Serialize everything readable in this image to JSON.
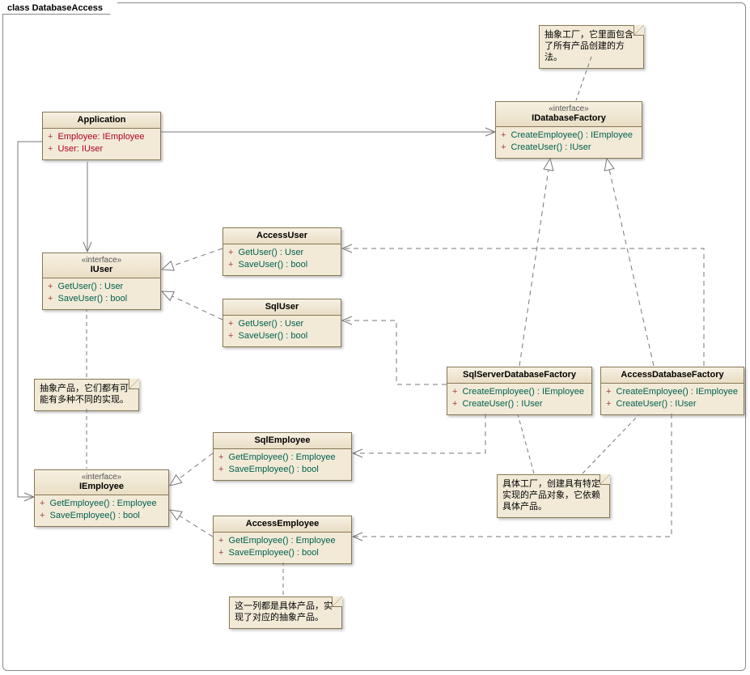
{
  "frame": {
    "title": "class DatabaseAccess"
  },
  "classes": {
    "Application": {
      "name": "Application",
      "attrs": [
        "Employee:  IEmployee",
        "User:  IUser"
      ]
    },
    "IDatabaseFactory": {
      "stereo": "«interface»",
      "name": "IDatabaseFactory",
      "ops": [
        "CreateEmployee() : IEmployee",
        "CreateUser() : IUser"
      ]
    },
    "IUser": {
      "stereo": "«interface»",
      "name": "IUser",
      "ops": [
        "GetUser() : User",
        "SaveUser() : bool"
      ]
    },
    "AccessUser": {
      "name": "AccessUser",
      "ops": [
        "GetUser() : User",
        "SaveUser() : bool"
      ]
    },
    "SqlUser": {
      "name": "SqlUser",
      "ops": [
        "GetUser() : User",
        "SaveUser() : bool"
      ]
    },
    "IEmployee": {
      "stereo": "«interface»",
      "name": "IEmployee",
      "ops": [
        "GetEmployee() : Employee",
        "SaveEmployee() : bool"
      ]
    },
    "SqlEmployee": {
      "name": "SqlEmployee",
      "ops": [
        "GetEmployee() : Employee",
        "SaveEmployee() : bool"
      ]
    },
    "AccessEmployee": {
      "name": "AccessEmployee",
      "ops": [
        "GetEmployee() : Employee",
        "SaveEmployee() : bool"
      ]
    },
    "SqlServerDatabaseFactory": {
      "name": "SqlServerDatabaseFactory",
      "ops": [
        "CreateEmployee() : IEmployee",
        "CreateUser() : IUser"
      ]
    },
    "AccessDatabaseFactory": {
      "name": "AccessDatabaseFactory",
      "ops": [
        "CreateEmployee() : IEmployee",
        "CreateUser() : IUser"
      ]
    }
  },
  "notes": {
    "n1": "抽象工厂，它里面包含了所有产品创建的方法。",
    "n2": "抽象产品，它们都有可能有多种不同的实现。",
    "n3": "具体工厂，创建具有特定实现的产品对象，它依赖具体产品。",
    "n4": "这一列都是具体产品，实现了对应的抽象产品。"
  }
}
